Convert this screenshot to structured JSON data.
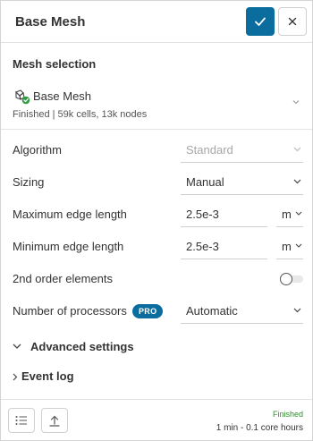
{
  "header": {
    "title": "Base Mesh",
    "confirm_icon": "check-icon",
    "close_icon": "close-icon"
  },
  "mesh_selection": {
    "title": "Mesh selection",
    "item_name": "Base Mesh",
    "item_status": "Finished | 59k cells, 13k nodes",
    "status_color": "#2e9a3e"
  },
  "fields": {
    "algorithm": {
      "label": "Algorithm",
      "value": "Standard"
    },
    "sizing": {
      "label": "Sizing",
      "value": "Manual"
    },
    "max_edge": {
      "label": "Maximum edge length",
      "value": "2.5e-3",
      "unit": "m"
    },
    "min_edge": {
      "label": "Minimum edge length",
      "value": "2.5e-3",
      "unit": "m"
    },
    "second_order": {
      "label": "2nd order elements",
      "enabled": false
    },
    "processors": {
      "label": "Number of processors",
      "badge": "PRO",
      "value": "Automatic"
    }
  },
  "advanced": {
    "label": "Advanced settings",
    "expanded": true
  },
  "event_log": {
    "label": "Event log",
    "expanded": false
  },
  "footer": {
    "status": "Finished",
    "duration": "1 min - 0.1 core hours",
    "list_icon": "list-icon",
    "upload_icon": "upload-icon"
  },
  "colors": {
    "accent": "#0a6d9e",
    "success": "#2e8b2e"
  }
}
